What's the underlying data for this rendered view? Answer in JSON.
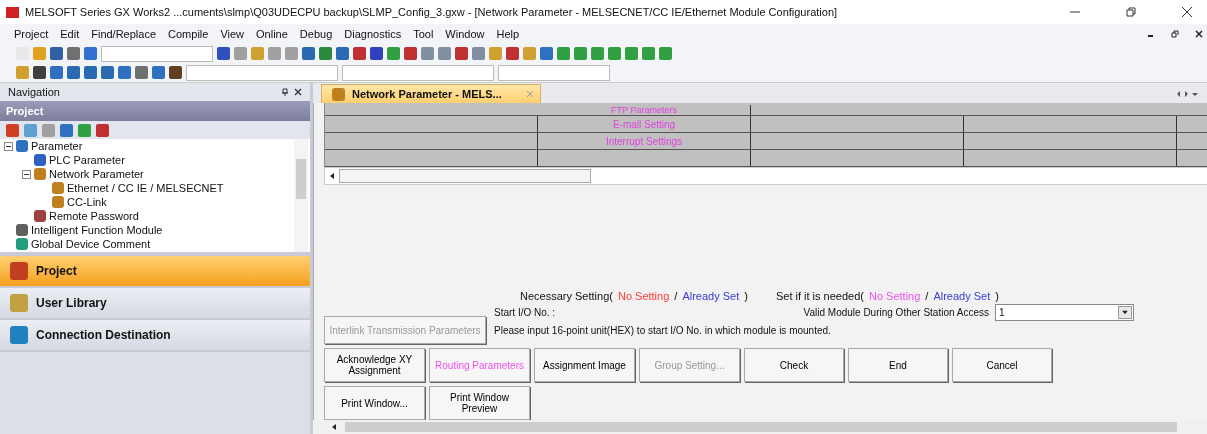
{
  "window": {
    "title": "MELSOFT Series GX Works2 ...cuments\\slmp\\Q03UDECPU backup\\SLMP_Config_3.gxw - [Network Parameter - MELSECNET/CC IE/Ethernet Module Configuration]"
  },
  "menu": [
    "Project",
    "Edit",
    "Find/Replace",
    "Compile",
    "View",
    "Online",
    "Debug",
    "Diagnostics",
    "Tool",
    "Window",
    "Help"
  ],
  "navigation": {
    "title": "Navigation",
    "section": "Project",
    "tree": [
      {
        "label": "Parameter",
        "expanded": true,
        "children": [
          {
            "label": "PLC Parameter"
          },
          {
            "label": "Network Parameter",
            "expanded": true,
            "children": [
              {
                "label": "Ethernet / CC IE / MELSECNET"
              },
              {
                "label": "CC-Link"
              }
            ]
          },
          {
            "label": "Remote Password"
          }
        ]
      },
      {
        "label": "Intelligent Function Module"
      },
      {
        "label": "Global Device Comment"
      }
    ],
    "tabs": [
      {
        "label": "Project",
        "selected": true
      },
      {
        "label": "User Library",
        "selected": false
      },
      {
        "label": "Connection Destination",
        "selected": false
      }
    ]
  },
  "document_tab": {
    "label": "Network Parameter - MELS..."
  },
  "grid": {
    "rows": [
      "FTP Parameters",
      "E-mail Setting",
      "Interrupt Settings"
    ]
  },
  "legend": [
    {
      "label": "Necessary Setting(",
      "items": [
        {
          "text": "No Setting",
          "color": "#ff3b3b"
        },
        {
          "text": "Already Set",
          "color": "#3a3ad8"
        }
      ],
      "separator": "/",
      "close": ")"
    },
    {
      "label": "Set if it is needed(",
      "items": [
        {
          "text": "No Setting",
          "color": "#f050f0"
        },
        {
          "text": "Already Set",
          "color": "#3a3ad8"
        }
      ],
      "separator": "/",
      "close": ")"
    }
  ],
  "interlink_button": {
    "label": "Interlink Transmission Parameters",
    "disabled": true
  },
  "start_io": {
    "label": "Start I/O No. :",
    "hint": "Please input 16-point unit(HEX) to start I/O No. in which module is mounted."
  },
  "valid_module": {
    "label": "Valid Module During Other Station Access",
    "value": "1"
  },
  "buttons": [
    [
      {
        "label": "Acknowledge XY Assignment",
        "disabled": false,
        "kind": "normal"
      },
      {
        "label": "Routing Parameters",
        "disabled": false,
        "kind": "unset"
      },
      {
        "label": "Assignment Image",
        "disabled": false,
        "kind": "normal"
      },
      {
        "label": "Group Setting...",
        "disabled": true
      },
      {
        "label": "Check",
        "disabled": false,
        "kind": "normal"
      },
      {
        "label": "End",
        "disabled": false,
        "kind": "normal"
      },
      {
        "label": "Cancel",
        "disabled": false,
        "kind": "normal"
      }
    ],
    [
      {
        "label": "Print Window...",
        "disabled": false,
        "kind": "normal"
      },
      {
        "label": "Print Window Preview",
        "disabled": false,
        "kind": "normal"
      }
    ]
  ]
}
